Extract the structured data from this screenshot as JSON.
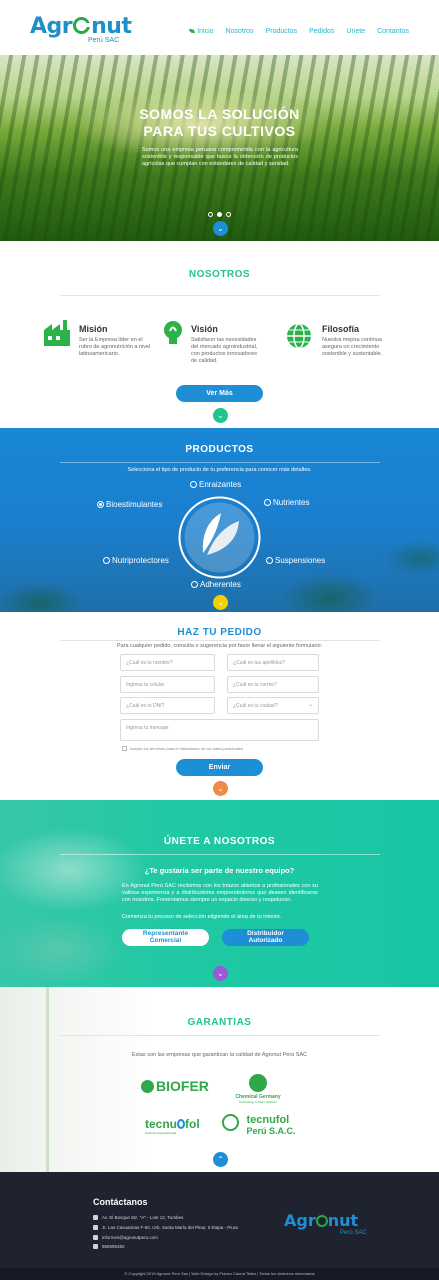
{
  "header": {
    "logo_main": "Agr",
    "logo_end": "nut",
    "logo_sub": "Perú SAC",
    "nav": [
      "Inicio",
      "Nosotros",
      "Productos",
      "Pedidos",
      "Unete",
      "Contantos"
    ]
  },
  "hero": {
    "title_line1": "SOMOS LA SOLUCIÓN",
    "title_line2": "PARA TUS CULTIVOS",
    "text": "Somos una empresa peruana comprometida con la agricultura sostenible y responsable que busca la obtención de productos agrícolas que cumplan con estándares de calidad y sanidad.",
    "slides": 3,
    "active_slide": 1
  },
  "nosotros": {
    "title": "NOSOTROS",
    "features": [
      {
        "icon": "factory-icon",
        "title": "Misión",
        "text": "Ser la Empresa líder en el rubro de agronutrición a nivel latinoamericano."
      },
      {
        "icon": "bulb-icon",
        "title": "Visión",
        "text": "Satisfacer las necesidades del mercado agroindustrial, con productos innovadores de calidad."
      },
      {
        "icon": "globe-icon",
        "title": "Filosofía",
        "text": "Nuestra mejora continua asegura un crecimiento sostenible y sustentable."
      }
    ],
    "button": "Ver Más"
  },
  "productos": {
    "title": "PRODUCTOS",
    "subtitle": "Selecciona el tipo de producto de tu preferencia para conocer más detalles.",
    "options": [
      "Enraizantes",
      "Nutrientes",
      "Bioestimulantes",
      "Nutriprotectores",
      "Suspensiones",
      "Adherentes"
    ],
    "selected": "Bioestimulantes"
  },
  "pedido": {
    "title": "HAZ TU PEDIDO",
    "subtitle": "Para cualquier pedido, consulta o sugerencia por favor llenar el siguiente formulario:",
    "fields": [
      "¿Cuál es tu nombre?",
      "¿Cuál es tus apellidos?",
      "Ingresa tu celular",
      "¿Cuál es tu correo?",
      "¿Cuál es tu DNI?",
      "¿Cuál es tu ciudad?"
    ],
    "message_placeholder": "Ingresa tu mensaje",
    "consent": "Acepto los términos para el tratamiento de los datos personales",
    "button": "Enviar"
  },
  "unete": {
    "title": "ÚNETE A NOSOTROS",
    "question": "¿Te gustaría ser parte de nuestro equipo?",
    "text": "En Agronut Perú SAC recibimos con los brazos abiertos a profesionales con su valiosa experiencia y a distribuidores emprendedores que deseen identificarse con nosotros. Fomentamos siempre un espacio diverso y respetuoso.",
    "text2": "Comienza tu proceso de selección eligiendo el área de tu interés.",
    "btn1_line1": "Representante",
    "btn1_line2": "Comercial",
    "btn2_line1": "Distribuidor",
    "btn2_line2": "Autorizado"
  },
  "garantias": {
    "title": "GARANTIAS",
    "subtitle": "Estas son las empresas que garantizan la calidad de Agronut Perú SAC",
    "brands": {
      "biofer": "BIOFER",
      "chem_line1": "Chemical Germany",
      "chem_line2": "Technology in Plant Nutrition",
      "tecnu1": "tecnu",
      "tecnu1_end": "fol",
      "tecnu1_sub": "Nutrición Especializada",
      "tecnu2": "tecnufol",
      "tecnu2_sub": "Perú S.A.C."
    }
  },
  "footer": {
    "title": "Contáctanos",
    "lines": [
      "Av. El Bosque Mz. \"A\" - Lote 12, Tumbes",
      "Jr. Las Casuarinas F-50, Urb. Santa María del Pinar, II Etapa - Piura",
      "informes@agronutperu.com",
      "969595482"
    ],
    "copyright": "© Copyright 2019 Agronut Perú Sac  |  Web Design by Franco Cauna Tellez  |  Todos los derechos reservados"
  },
  "colors": {
    "green": "#22c38e",
    "blue": "#1e8fd6",
    "teal": "#20c8a3",
    "dark": "#1f2330"
  }
}
